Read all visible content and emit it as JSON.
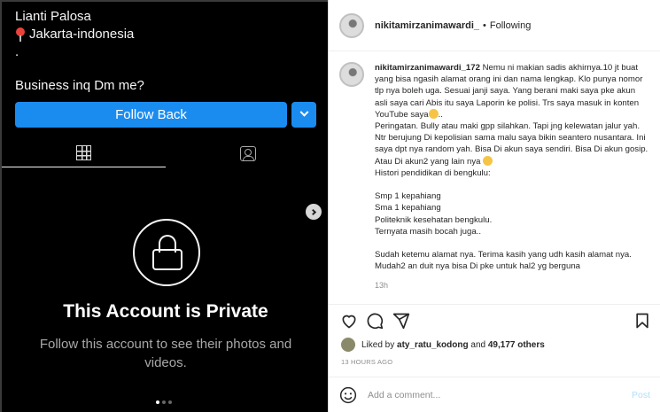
{
  "profile": {
    "name": "Lianti Palosa",
    "location": "Jakarta-indonesia",
    "dot": ".",
    "business": "Business inq Dm me?",
    "follow_back_label": "Follow Back",
    "private_title": "This Account is Private",
    "private_subtitle": "Follow this account to see their photos and videos."
  },
  "post": {
    "header": {
      "username": "nikitamirzanimawardi_",
      "separator": "•",
      "following_label": "Following"
    },
    "caption": {
      "username": "nikitamirzanimawardi_172",
      "lines": [
        "Nemu ni makian sadis akhirnya.10 jt buat yang bisa ngasih alamat orang ini dan nama lengkap. Klo punya nomor tlp nya boleh uga. Sesuai janji saya. Yang berani maki saya pke akun asli saya cari Abis itu saya Laporin ke polisi. Trs saya masuk in konten YouTube saya",
        "..",
        "Peringatan. Bully atau maki gpp silahkan. Tapi jng kelewatan jalur yah. Ntr berujung Di kepolisian sama malu saya bikin seantero nusantara. Ini saya dpt nya random yah. Bisa Di akun saya sendiri. Bisa Di akun gosip. Atau Di akun2 yang lain nya",
        "Histori pendidikan di bengkulu:",
        "Smp 1 kepahiang",
        "Sma 1 kepahiang",
        "Politeknik kesehatan bengkulu.",
        "Ternyata masih bocah juga..",
        "Sudah ketemu alamat nya. Terima kasih yang udh kasih alamat nya. Mudah2 an duit nya bisa Di pke untuk hal2 yg berguna"
      ],
      "time": "13h"
    },
    "likes": {
      "prefix": "Liked by",
      "user": "aty_ratu_kodong",
      "joiner": "and",
      "others": "49,177 others"
    },
    "date": "13 HOURS AGO",
    "comment_placeholder": "Add a comment...",
    "post_label": "Post"
  },
  "colors": {
    "follow_button": "#1a8cf0",
    "left_bg": "#000000",
    "right_bg": "#ffffff"
  },
  "icons": [
    "pin-icon",
    "chevron-down-icon",
    "grid-icon",
    "tagged-icon",
    "next-arrow-icon",
    "lock-icon",
    "heart-icon",
    "comment-icon",
    "share-icon",
    "save-icon",
    "smile-icon"
  ]
}
